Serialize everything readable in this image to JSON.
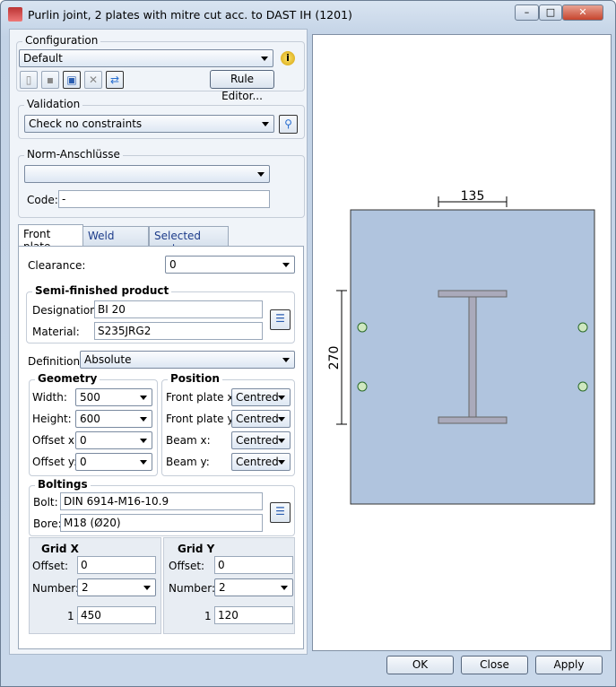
{
  "window": {
    "title": "Purlin joint, 2 plates with mitre cut acc. to DAST IH (1201)",
    "minimize": "–",
    "maximize": "□",
    "close": "✕"
  },
  "configuration": {
    "label": "Configuration",
    "value": "Default",
    "rule_editor": "Rule Editor..."
  },
  "validation": {
    "label": "Validation",
    "value": "Check no constraints"
  },
  "norm": {
    "label": "Norm-Anschlüsse",
    "value": "",
    "code_label": "Code:",
    "code_value": "-"
  },
  "tabs": [
    "Front plate",
    "Weld seams",
    "Selected parts"
  ],
  "front_plate": {
    "clearance_label": "Clearance:",
    "clearance": "0",
    "semi": {
      "label": "Semi-finished product",
      "designation_label": "Designation:",
      "designation": "BI 20",
      "material_label": "Material:",
      "material": "S235JRG2"
    },
    "definition_label": "Definition:",
    "definition": "Absolute",
    "geometry": {
      "label": "Geometry",
      "fields": [
        {
          "label": "Width:",
          "value": "500"
        },
        {
          "label": "Height:",
          "value": "600"
        },
        {
          "label": "Offset x:",
          "value": "0"
        },
        {
          "label": "Offset y:",
          "value": "0"
        }
      ]
    },
    "position": {
      "label": "Position",
      "fields": [
        {
          "label": "Front plate x:",
          "value": "Centred"
        },
        {
          "label": "Front plate y:",
          "value": "Centred"
        },
        {
          "label": "Beam x:",
          "value": "Centred"
        },
        {
          "label": "Beam y:",
          "value": "Centred"
        }
      ]
    },
    "boltings": {
      "label": "Boltings",
      "bolt_label": "Bolt:",
      "bolt": "DIN 6914-M16-10.9",
      "bore_label": "Bore:",
      "bore": "M18 (Ø20)"
    },
    "grid_x": {
      "label": "Grid X",
      "offset_label": "Offset:",
      "offset": "0",
      "number_label": "Number:",
      "number": "2",
      "row_index": "1",
      "row_value": "450"
    },
    "grid_y": {
      "label": "Grid Y",
      "offset_label": "Offset:",
      "offset": "0",
      "number_label": "Number:",
      "number": "2",
      "row_index": "1",
      "row_value": "120"
    }
  },
  "drawing": {
    "dim_top": "135",
    "dim_left": "270",
    "plate_color": "#b0c4de"
  },
  "footer": {
    "ok": "OK",
    "close": "Close",
    "apply": "Apply"
  }
}
